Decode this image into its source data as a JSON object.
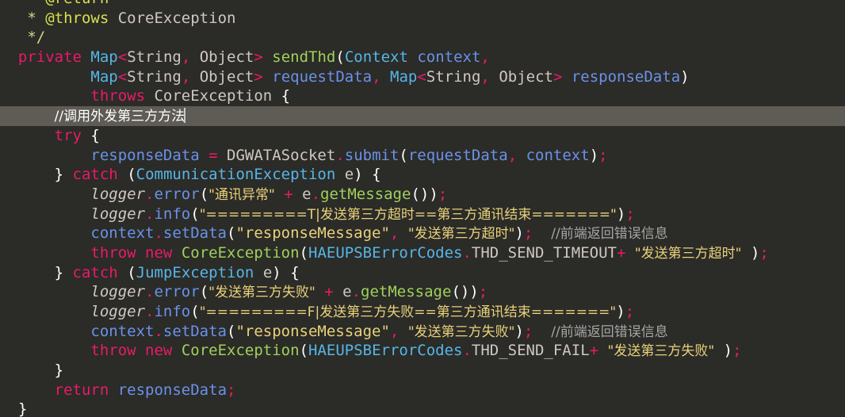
{
  "editor": {
    "language": "java",
    "theme": "dark",
    "background_color": "#2b2b28",
    "current_line_highlight_color": "#5f5b55",
    "caret_color": "#c8c8c8"
  },
  "palette": {
    "keyword": "#e81b68",
    "type": "#56b6e6",
    "method": "#9fd15a",
    "variable": "#6a92e8",
    "string": "#e9d27a",
    "comment": "#a6a6a6",
    "javadoc": "#d4d48a",
    "javadoc_tag": "#d7e04f",
    "plain": "#cfc8c0",
    "punctuation": "#e81b68",
    "bracket": "#ffffff"
  },
  "code": {
    "lines": [
      {
        "id": "line-return-tag",
        "clipped_top": true,
        "current": false,
        "tokens": [
          {
            "t": "   * ",
            "c": "jdoc"
          },
          {
            "t": "@return",
            "c": "jdoctag"
          }
        ]
      },
      {
        "id": "line-throws-tag",
        "current": false,
        "tokens": [
          {
            "t": "   * ",
            "c": "jdoc"
          },
          {
            "t": "@throws",
            "c": "jdoctag"
          },
          {
            "t": " ",
            "c": "jdoc"
          },
          {
            "t": "CoreException",
            "c": "plain"
          }
        ]
      },
      {
        "id": "line-jdoc-close",
        "current": false,
        "tokens": [
          {
            "t": "   */",
            "c": "jdoc"
          }
        ]
      },
      {
        "id": "line-signature-1",
        "current": false,
        "tokens": [
          {
            "t": "  ",
            "c": "plain"
          },
          {
            "t": "private",
            "c": "kw"
          },
          {
            "t": " ",
            "c": "plain"
          },
          {
            "t": "Map",
            "c": "type"
          },
          {
            "t": "<",
            "c": "angle"
          },
          {
            "t": "String",
            "c": "plain"
          },
          {
            "t": ",",
            "c": "punct"
          },
          {
            "t": " Object",
            "c": "plain"
          },
          {
            "t": ">",
            "c": "angle"
          },
          {
            "t": " ",
            "c": "plain"
          },
          {
            "t": "sendThd",
            "c": "method"
          },
          {
            "t": "(",
            "c": "paren"
          },
          {
            "t": "Context",
            "c": "type"
          },
          {
            "t": " ",
            "c": "plain"
          },
          {
            "t": "context",
            "c": "var"
          },
          {
            "t": ",",
            "c": "punct"
          }
        ]
      },
      {
        "id": "line-signature-2",
        "current": false,
        "tokens": [
          {
            "t": "          ",
            "c": "plain"
          },
          {
            "t": "Map",
            "c": "type"
          },
          {
            "t": "<",
            "c": "angle"
          },
          {
            "t": "String",
            "c": "plain"
          },
          {
            "t": ",",
            "c": "punct"
          },
          {
            "t": " Object",
            "c": "plain"
          },
          {
            "t": ">",
            "c": "angle"
          },
          {
            "t": " ",
            "c": "plain"
          },
          {
            "t": "requestData",
            "c": "var"
          },
          {
            "t": ",",
            "c": "punct"
          },
          {
            "t": " ",
            "c": "plain"
          },
          {
            "t": "Map",
            "c": "type"
          },
          {
            "t": "<",
            "c": "angle"
          },
          {
            "t": "String",
            "c": "plain"
          },
          {
            "t": ",",
            "c": "punct"
          },
          {
            "t": " Object",
            "c": "plain"
          },
          {
            "t": ">",
            "c": "angle"
          },
          {
            "t": " ",
            "c": "plain"
          },
          {
            "t": "responseData",
            "c": "var"
          },
          {
            "t": ")",
            "c": "paren"
          }
        ]
      },
      {
        "id": "line-throws-clause",
        "current": false,
        "tokens": [
          {
            "t": "          ",
            "c": "plain"
          },
          {
            "t": "throws",
            "c": "kw"
          },
          {
            "t": " ",
            "c": "plain"
          },
          {
            "t": "CoreException",
            "c": "plain"
          },
          {
            "t": " ",
            "c": "plain"
          },
          {
            "t": "{",
            "c": "paren"
          }
        ]
      },
      {
        "id": "line-comment-invoke",
        "current": true,
        "tokens": [
          {
            "t": "      ",
            "c": "plain"
          },
          {
            "t": "//调用外发第三方方法",
            "c": "comment"
          },
          {
            "t": "",
            "c": "caret"
          }
        ]
      },
      {
        "id": "line-try",
        "current": false,
        "tokens": [
          {
            "t": "      ",
            "c": "plain"
          },
          {
            "t": "try",
            "c": "kw"
          },
          {
            "t": " ",
            "c": "plain"
          },
          {
            "t": "{",
            "c": "paren"
          }
        ]
      },
      {
        "id": "line-submit",
        "current": false,
        "tokens": [
          {
            "t": "          ",
            "c": "plain"
          },
          {
            "t": "responseData",
            "c": "var"
          },
          {
            "t": " ",
            "c": "plain"
          },
          {
            "t": "=",
            "c": "op"
          },
          {
            "t": " ",
            "c": "plain"
          },
          {
            "t": "DGWATASocket",
            "c": "plain"
          },
          {
            "t": ".",
            "c": "punct"
          },
          {
            "t": "submit",
            "c": "var"
          },
          {
            "t": "(",
            "c": "paren"
          },
          {
            "t": "requestData",
            "c": "var"
          },
          {
            "t": ",",
            "c": "punct"
          },
          {
            "t": " ",
            "c": "plain"
          },
          {
            "t": "context",
            "c": "var"
          },
          {
            "t": ")",
            "c": "paren"
          },
          {
            "t": ";",
            "c": "punct"
          }
        ]
      },
      {
        "id": "line-catch-communication",
        "current": false,
        "tokens": [
          {
            "t": "      ",
            "c": "plain"
          },
          {
            "t": "}",
            "c": "paren"
          },
          {
            "t": " ",
            "c": "plain"
          },
          {
            "t": "catch",
            "c": "kw"
          },
          {
            "t": " ",
            "c": "plain"
          },
          {
            "t": "(",
            "c": "paren"
          },
          {
            "t": "CommunicationException",
            "c": "type"
          },
          {
            "t": " ",
            "c": "plain"
          },
          {
            "t": "e",
            "c": "ident"
          },
          {
            "t": ")",
            "c": "paren"
          },
          {
            "t": " ",
            "c": "plain"
          },
          {
            "t": "{",
            "c": "paren"
          }
        ]
      },
      {
        "id": "line-logger-error-1",
        "current": false,
        "tokens": [
          {
            "t": "          ",
            "c": "plain"
          },
          {
            "t": "logger",
            "c": "logger"
          },
          {
            "t": ".",
            "c": "punct"
          },
          {
            "t": "error",
            "c": "var"
          },
          {
            "t": "(",
            "c": "paren"
          },
          {
            "t": "\"通讯异常\"",
            "c": "string"
          },
          {
            "t": " ",
            "c": "plain"
          },
          {
            "t": "+",
            "c": "op"
          },
          {
            "t": " ",
            "c": "plain"
          },
          {
            "t": "e",
            "c": "ident"
          },
          {
            "t": ".",
            "c": "punct"
          },
          {
            "t": "getMessage",
            "c": "method"
          },
          {
            "t": "()",
            "c": "paren"
          },
          {
            "t": ")",
            "c": "paren"
          },
          {
            "t": ";",
            "c": "punct"
          }
        ]
      },
      {
        "id": "line-logger-info-1",
        "current": false,
        "tokens": [
          {
            "t": "          ",
            "c": "plain"
          },
          {
            "t": "logger",
            "c": "logger"
          },
          {
            "t": ".",
            "c": "punct"
          },
          {
            "t": "info",
            "c": "var"
          },
          {
            "t": "(",
            "c": "paren"
          },
          {
            "t": "\"=========T|发送第三方超时==第三方通讯结束=======\"",
            "c": "string"
          },
          {
            "t": ")",
            "c": "paren"
          },
          {
            "t": ";",
            "c": "punct"
          }
        ]
      },
      {
        "id": "line-setdata-1",
        "current": false,
        "tokens": [
          {
            "t": "          ",
            "c": "plain"
          },
          {
            "t": "context",
            "c": "var"
          },
          {
            "t": ".",
            "c": "punct"
          },
          {
            "t": "setData",
            "c": "var"
          },
          {
            "t": "(",
            "c": "paren"
          },
          {
            "t": "\"responseMessage\"",
            "c": "string"
          },
          {
            "t": ",",
            "c": "punct"
          },
          {
            "t": " ",
            "c": "plain"
          },
          {
            "t": "\"发送第三方超时\"",
            "c": "string"
          },
          {
            "t": ")",
            "c": "paren"
          },
          {
            "t": ";",
            "c": "punct"
          },
          {
            "t": "  ",
            "c": "plain"
          },
          {
            "t": "//前端返回错误信息",
            "c": "comment"
          }
        ]
      },
      {
        "id": "line-throw-timeout",
        "current": false,
        "tokens": [
          {
            "t": "          ",
            "c": "plain"
          },
          {
            "t": "throw",
            "c": "kw"
          },
          {
            "t": " ",
            "c": "plain"
          },
          {
            "t": "new",
            "c": "kw"
          },
          {
            "t": " ",
            "c": "plain"
          },
          {
            "t": "CoreException",
            "c": "method"
          },
          {
            "t": "(",
            "c": "paren"
          },
          {
            "t": "HAEUPSBErrorCodes",
            "c": "type"
          },
          {
            "t": ".",
            "c": "punct"
          },
          {
            "t": "THD_SEND_TIMEOUT",
            "c": "field"
          },
          {
            "t": "+",
            "c": "op"
          },
          {
            "t": " ",
            "c": "plain"
          },
          {
            "t": "\"发送第三方超时\"",
            "c": "string"
          },
          {
            "t": " ",
            "c": "plain"
          },
          {
            "t": ")",
            "c": "paren"
          },
          {
            "t": ";",
            "c": "punct"
          }
        ]
      },
      {
        "id": "line-catch-jump",
        "current": false,
        "tokens": [
          {
            "t": "      ",
            "c": "plain"
          },
          {
            "t": "}",
            "c": "paren"
          },
          {
            "t": " ",
            "c": "plain"
          },
          {
            "t": "catch",
            "c": "kw"
          },
          {
            "t": " ",
            "c": "plain"
          },
          {
            "t": "(",
            "c": "paren"
          },
          {
            "t": "JumpException",
            "c": "type"
          },
          {
            "t": " ",
            "c": "plain"
          },
          {
            "t": "e",
            "c": "ident"
          },
          {
            "t": ")",
            "c": "paren"
          },
          {
            "t": " ",
            "c": "plain"
          },
          {
            "t": "{",
            "c": "paren"
          }
        ]
      },
      {
        "id": "line-logger-error-2",
        "current": false,
        "tokens": [
          {
            "t": "          ",
            "c": "plain"
          },
          {
            "t": "logger",
            "c": "logger"
          },
          {
            "t": ".",
            "c": "punct"
          },
          {
            "t": "error",
            "c": "var"
          },
          {
            "t": "(",
            "c": "paren"
          },
          {
            "t": "\"发送第三方失败\"",
            "c": "string"
          },
          {
            "t": " ",
            "c": "plain"
          },
          {
            "t": "+",
            "c": "op"
          },
          {
            "t": " ",
            "c": "plain"
          },
          {
            "t": "e",
            "c": "ident"
          },
          {
            "t": ".",
            "c": "punct"
          },
          {
            "t": "getMessage",
            "c": "method"
          },
          {
            "t": "()",
            "c": "paren"
          },
          {
            "t": ")",
            "c": "paren"
          },
          {
            "t": ";",
            "c": "punct"
          }
        ]
      },
      {
        "id": "line-logger-info-2",
        "current": false,
        "tokens": [
          {
            "t": "          ",
            "c": "plain"
          },
          {
            "t": "logger",
            "c": "logger"
          },
          {
            "t": ".",
            "c": "punct"
          },
          {
            "t": "info",
            "c": "var"
          },
          {
            "t": "(",
            "c": "paren"
          },
          {
            "t": "\"=========F|发送第三方失败==第三方通讯结束=======\"",
            "c": "string"
          },
          {
            "t": ")",
            "c": "paren"
          },
          {
            "t": ";",
            "c": "punct"
          }
        ]
      },
      {
        "id": "line-setdata-2",
        "current": false,
        "tokens": [
          {
            "t": "          ",
            "c": "plain"
          },
          {
            "t": "context",
            "c": "var"
          },
          {
            "t": ".",
            "c": "punct"
          },
          {
            "t": "setData",
            "c": "var"
          },
          {
            "t": "(",
            "c": "paren"
          },
          {
            "t": "\"responseMessage\"",
            "c": "string"
          },
          {
            "t": ",",
            "c": "punct"
          },
          {
            "t": " ",
            "c": "plain"
          },
          {
            "t": "\"发送第三方失败\"",
            "c": "string"
          },
          {
            "t": ")",
            "c": "paren"
          },
          {
            "t": ";",
            "c": "punct"
          },
          {
            "t": "  ",
            "c": "plain"
          },
          {
            "t": "//前端返回错误信息",
            "c": "comment"
          }
        ]
      },
      {
        "id": "line-throw-fail",
        "current": false,
        "tokens": [
          {
            "t": "          ",
            "c": "plain"
          },
          {
            "t": "throw",
            "c": "kw"
          },
          {
            "t": " ",
            "c": "plain"
          },
          {
            "t": "new",
            "c": "kw"
          },
          {
            "t": " ",
            "c": "plain"
          },
          {
            "t": "CoreException",
            "c": "method"
          },
          {
            "t": "(",
            "c": "paren"
          },
          {
            "t": "HAEUPSBErrorCodes",
            "c": "type"
          },
          {
            "t": ".",
            "c": "punct"
          },
          {
            "t": "THD_SEND_FAIL",
            "c": "field"
          },
          {
            "t": "+",
            "c": "op"
          },
          {
            "t": " ",
            "c": "plain"
          },
          {
            "t": "\"发送第三方失败\"",
            "c": "string"
          },
          {
            "t": " ",
            "c": "plain"
          },
          {
            "t": ")",
            "c": "paren"
          },
          {
            "t": ";",
            "c": "punct"
          }
        ]
      },
      {
        "id": "line-close-catch",
        "current": false,
        "tokens": [
          {
            "t": "      ",
            "c": "plain"
          },
          {
            "t": "}",
            "c": "paren"
          }
        ]
      },
      {
        "id": "line-return",
        "current": false,
        "tokens": [
          {
            "t": "      ",
            "c": "plain"
          },
          {
            "t": "return",
            "c": "kw"
          },
          {
            "t": " ",
            "c": "plain"
          },
          {
            "t": "responseData",
            "c": "var"
          },
          {
            "t": ";",
            "c": "punct"
          }
        ]
      },
      {
        "id": "line-close-method",
        "current": false,
        "tokens": [
          {
            "t": "  ",
            "c": "plain"
          },
          {
            "t": "}",
            "c": "paren"
          }
        ]
      }
    ]
  }
}
